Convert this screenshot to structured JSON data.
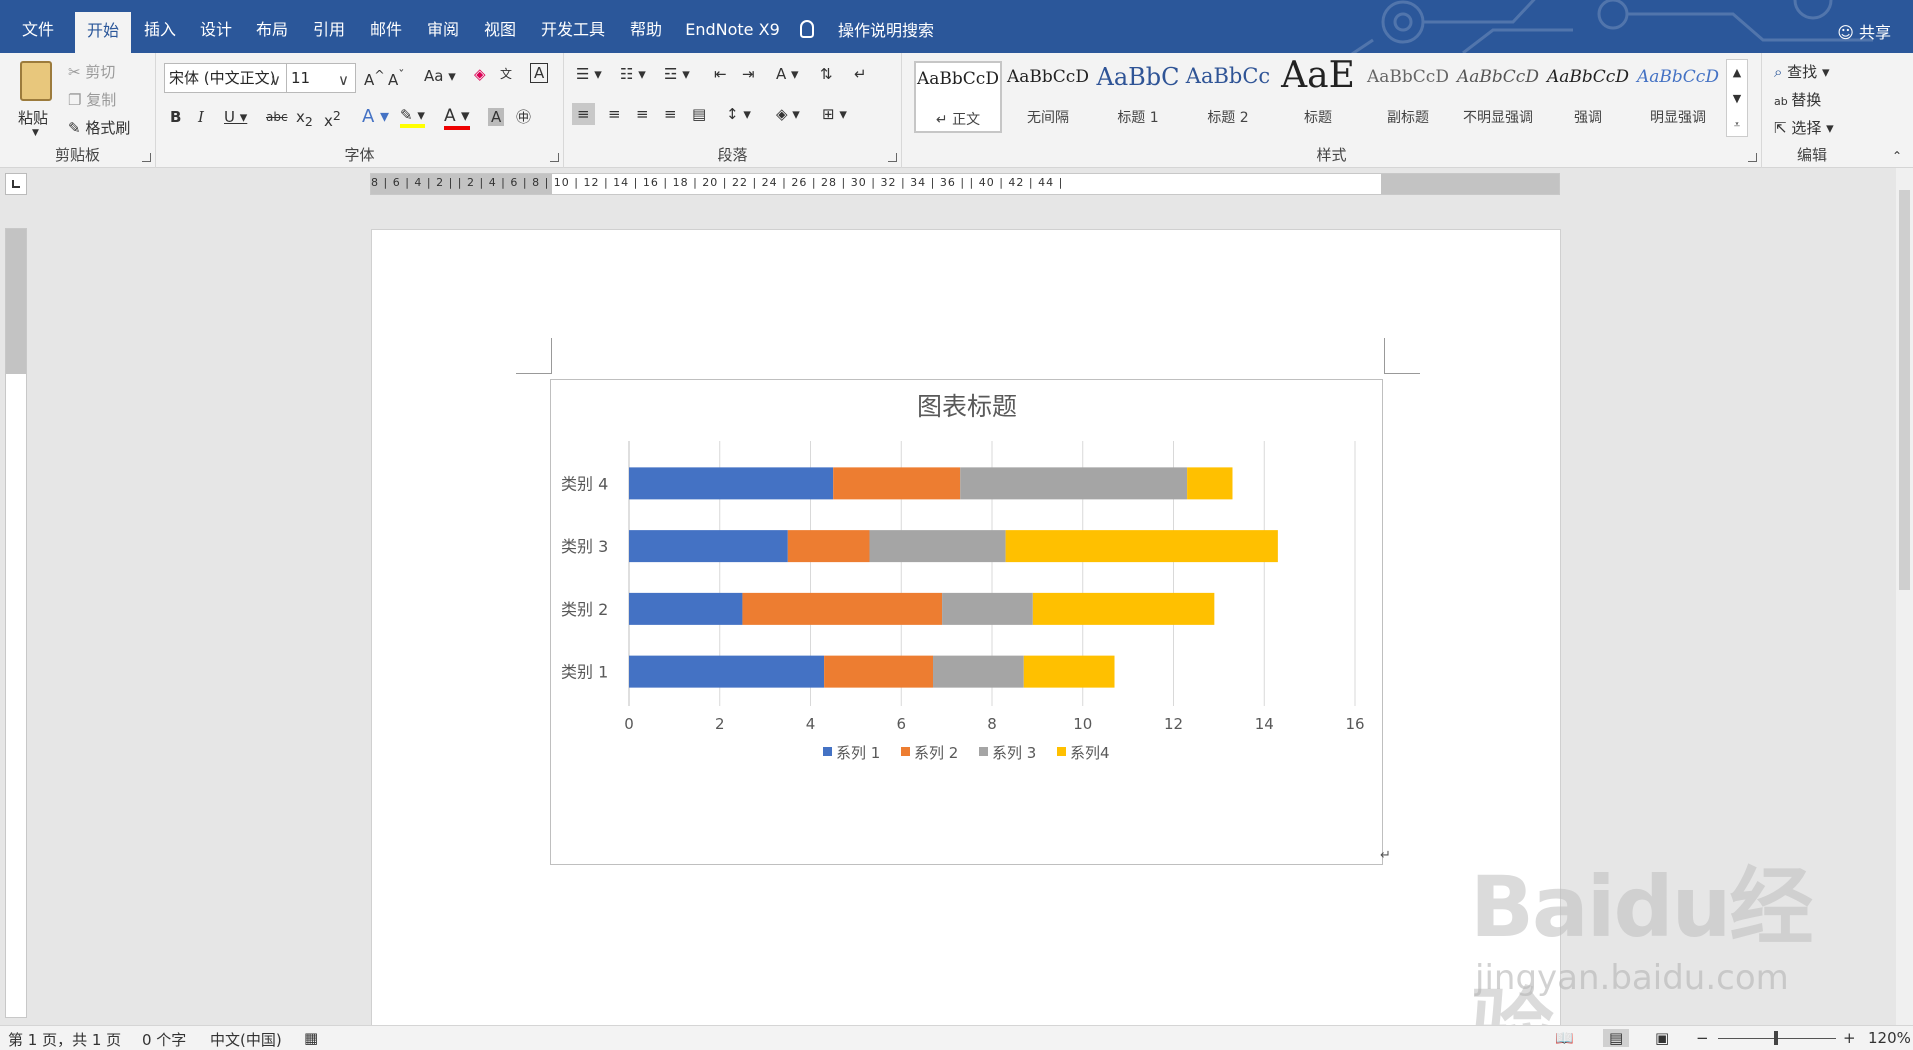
{
  "tabs": {
    "file": "文件",
    "home": "开始",
    "insert": "插入",
    "design": "设计",
    "layout": "布局",
    "references": "引用",
    "mailings": "邮件",
    "review": "审阅",
    "view": "视图",
    "developer": "开发工具",
    "help": "帮助",
    "endnote": "EndNote X9",
    "tellme": "操作说明搜索",
    "share": "共享"
  },
  "clipboard": {
    "paste": "粘贴",
    "cut": "剪切",
    "copy": "复制",
    "format_painter": "格式刷",
    "label": "剪贴板"
  },
  "font": {
    "name": "宋体 (中文正文)",
    "size": "11",
    "case": "Aa",
    "label": "字体"
  },
  "paragraph": {
    "label": "段落"
  },
  "styles": {
    "label": "样式",
    "items": [
      {
        "preview": "AaBbCcD",
        "name": "↵ 正文"
      },
      {
        "preview": "AaBbCcD",
        "name": "无间隔"
      },
      {
        "preview": "AaBbC",
        "name": "标题 1"
      },
      {
        "preview": "AaBbCc",
        "name": "标题 2"
      },
      {
        "preview": "AaE",
        "name": "标题"
      },
      {
        "preview": "AaBbCcD",
        "name": "副标题"
      },
      {
        "preview": "AaBbCcD",
        "name": "不明显强调"
      },
      {
        "preview": "AaBbCcD",
        "name": "强调"
      },
      {
        "preview": "AaBbCcD",
        "name": "明显强调"
      }
    ]
  },
  "editing": {
    "find": "查找",
    "replace": "替换",
    "select": "选择",
    "label": "编辑"
  },
  "ruler": {
    "h": "8 | 6 | 4 | 2 |  | 2 | 4 | 6 | 8 | 10 | 12 | 14 | 16 | 18 | 20 | 22 | 24 | 26 | 28 | 30 | 32 | 34 | 36 |  | 40 | 42 | 44 |"
  },
  "status": {
    "page": "第 1 页，共 1 页",
    "words": "0 个字",
    "lang": "中文(中国)",
    "zoom": "120%"
  },
  "watermark": {
    "brand": "Baidu经验",
    "url": "jingyan.baidu.com"
  },
  "colors": {
    "series1": "#4472c4",
    "series2": "#ed7d31",
    "series3": "#a5a5a5",
    "series4": "#ffc000",
    "accent": "#2b579a"
  },
  "chart_data": {
    "type": "bar",
    "orientation": "horizontal",
    "stacked": true,
    "title": "图表标题",
    "categories": [
      "类别 1",
      "类别 2",
      "类别 3",
      "类别 4"
    ],
    "series": [
      {
        "name": "系列 1",
        "values": [
          4.3,
          2.5,
          3.5,
          4.5
        ]
      },
      {
        "name": "系列 2",
        "values": [
          2.4,
          4.4,
          1.8,
          2.8
        ]
      },
      {
        "name": "系列 3",
        "values": [
          2.0,
          2.0,
          3.0,
          5.0
        ]
      },
      {
        "name": "系列4",
        "values": [
          2.0,
          4.0,
          6.0,
          1.0
        ]
      }
    ],
    "xlim": [
      0,
      16
    ],
    "xticks": [
      "0",
      "2",
      "4",
      "6",
      "8",
      "10",
      "12",
      "14",
      "16"
    ],
    "grid": true,
    "legend": "bottom"
  }
}
